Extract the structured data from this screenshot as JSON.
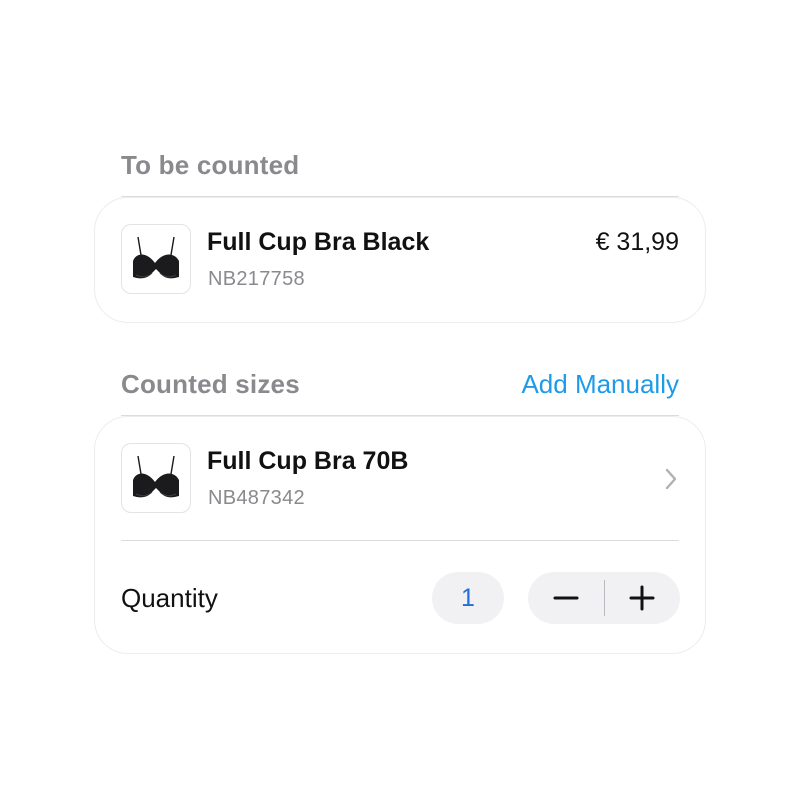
{
  "to_be_counted": {
    "title": "To be counted",
    "item": {
      "name": "Full Cup Bra Black",
      "sku": "NB217758",
      "price": "€ 31,99",
      "image_icon": "bra-thumbnail-icon"
    }
  },
  "counted_sizes": {
    "title": "Counted sizes",
    "add_manually_label": "Add Manually",
    "item": {
      "name": "Full Cup Bra 70B",
      "sku": "NB487342",
      "image_icon": "bra-thumbnail-icon",
      "chevron_icon": "chevron-right-icon"
    },
    "quantity": {
      "label": "Quantity",
      "value": "1",
      "decrement_icon": "minus-icon",
      "increment_icon": "plus-icon"
    }
  },
  "colors": {
    "accent": "#1e9be8",
    "quantity_value": "#1e6fd9",
    "section_title": "#8a8a8e",
    "pill_background": "#f1f1f3"
  }
}
